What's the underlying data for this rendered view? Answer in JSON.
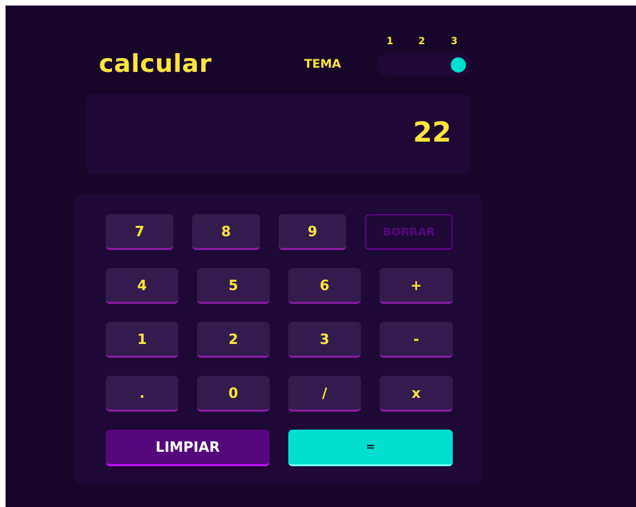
{
  "app": {
    "title": "calcular"
  },
  "theme": {
    "label": "TEMA",
    "options": [
      "1",
      "2",
      "3"
    ],
    "selected": "3"
  },
  "display": {
    "value": "22"
  },
  "keypad": {
    "row1": [
      "7",
      "8",
      "9",
      "BORRAR"
    ],
    "row2": [
      "4",
      "5",
      "6",
      "+"
    ],
    "row3": [
      "1",
      "2",
      "3",
      "-"
    ],
    "row4": [
      ".",
      "0",
      "/",
      "x"
    ],
    "clear_label": "LIMPIAR",
    "equals_label": "="
  },
  "colors": {
    "background": "#17062a",
    "panel": "#1e0836",
    "key": "#331c4d",
    "key_shadow": "#881c9e",
    "text_accent": "#ffe53d",
    "clear_key": "#56077c",
    "equals_key": "#00decf"
  }
}
